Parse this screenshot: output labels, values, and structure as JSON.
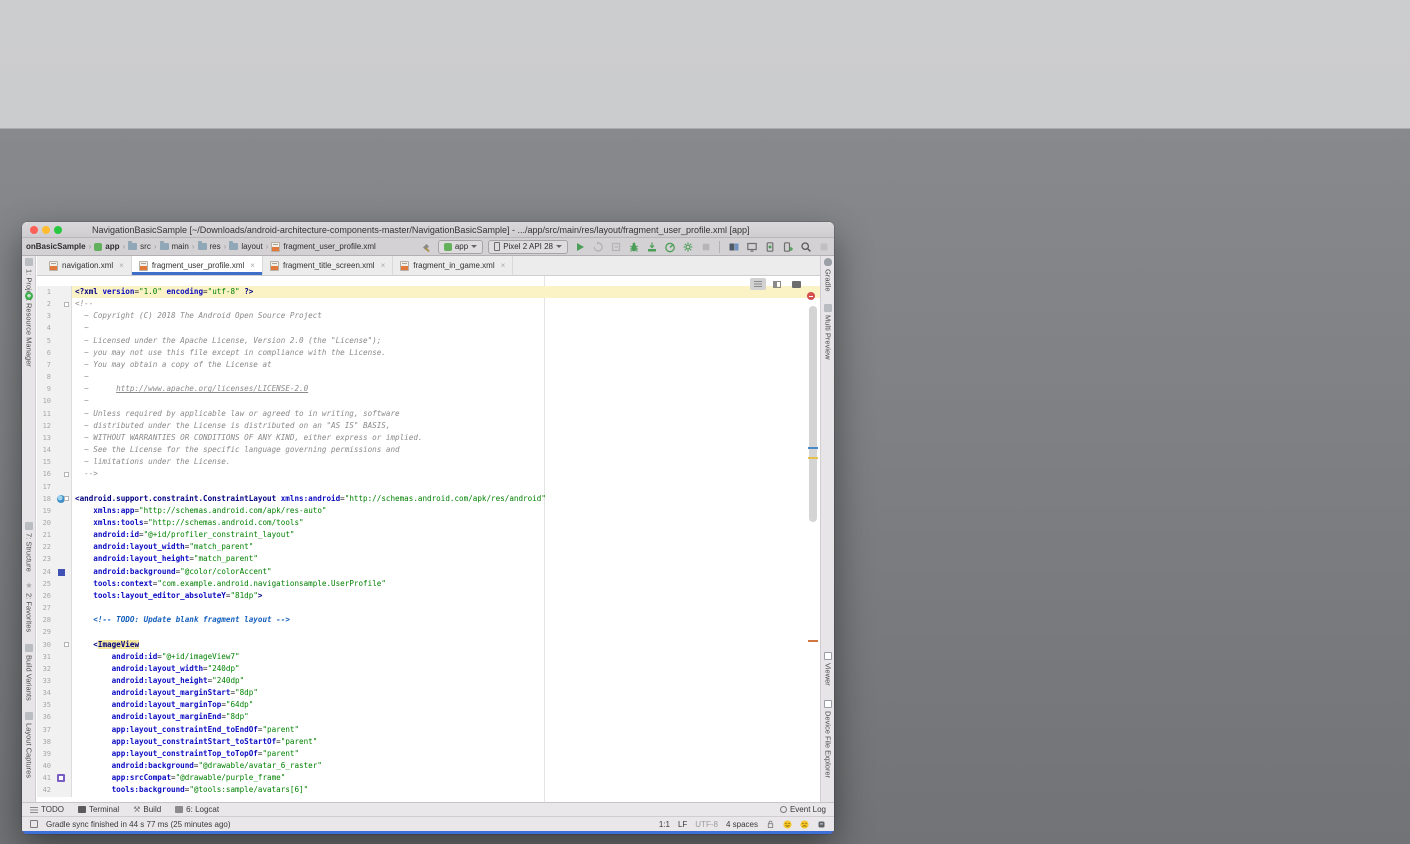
{
  "window": {
    "title": "NavigationBasicSample [~/Downloads/android-architecture-components-master/NavigationBasicSample] - .../app/src/main/res/layout/fragment_user_profile.xml [app]"
  },
  "breadcrumbs": [
    {
      "label": "onBasicSample",
      "icon": "none"
    },
    {
      "label": "app",
      "icon": "module"
    },
    {
      "label": "src",
      "icon": "folder"
    },
    {
      "label": "main",
      "icon": "folder"
    },
    {
      "label": "res",
      "icon": "folder"
    },
    {
      "label": "layout",
      "icon": "folder"
    },
    {
      "label": "fragment_user_profile.xml",
      "icon": "xml"
    }
  ],
  "toolbar": {
    "run_config_label": "app",
    "device_label": "Pixel 2 API 28",
    "icons_left": [
      "hammer"
    ],
    "icons_run_group": [
      "run",
      "apply-changes",
      "apply-code-changes",
      "debug",
      "attach-debugger",
      "profile",
      "profiler-settings",
      "stop"
    ],
    "icons_right_group": [
      "sync-gradle",
      "layout-validation",
      "avd-manager",
      "attach-debugger-to-process",
      "search-everywhere",
      "project-structure"
    ]
  },
  "tabs": [
    {
      "label": "navigation.xml",
      "active": false
    },
    {
      "label": "fragment_user_profile.xml",
      "active": true
    },
    {
      "label": "fragment_title_screen.xml",
      "active": false
    },
    {
      "label": "fragment_in_game.xml",
      "active": false
    }
  ],
  "left_strip": [
    {
      "label": "1: Project",
      "icon": "project"
    },
    {
      "label": "Resource Manager",
      "icon": "resource-manager"
    },
    {
      "label": "7: Structure",
      "icon": "structure"
    },
    {
      "label": "2: Favorites",
      "icon": "favorites"
    },
    {
      "label": "Build Variants",
      "icon": "build-variants"
    },
    {
      "label": "Layout Captures",
      "icon": "layout-captures"
    }
  ],
  "right_strip": [
    {
      "label": "Gradle",
      "icon": "gradle"
    },
    {
      "label": "Multi Preview",
      "icon": "multi-preview"
    },
    {
      "label": "Viewer",
      "icon": "viewer"
    },
    {
      "label": "Device File Explorer",
      "icon": "device-file-explorer"
    }
  ],
  "editor": {
    "view_modes": [
      "code",
      "split",
      "design"
    ],
    "active_view": "code",
    "caret_line": 1,
    "fold_lines": [
      2,
      16,
      18,
      30
    ],
    "gutter_icons": {
      "18": "preview",
      "24": "swatch",
      "41": "thumb"
    },
    "lines": [
      {
        "n": 1,
        "tokens": [
          [
            "<?xml ",
            "t"
          ],
          [
            "version",
            "a"
          ],
          [
            "=",
            "p"
          ],
          [
            "\"1.0\" ",
            "v"
          ],
          [
            "encoding",
            "a"
          ],
          [
            "=",
            "p"
          ],
          [
            "\"utf-8\" ",
            "v"
          ],
          [
            "?>",
            "t"
          ]
        ]
      },
      {
        "n": 2,
        "tokens": [
          [
            "<!--",
            "c"
          ]
        ]
      },
      {
        "n": 3,
        "tokens": [
          [
            "  ~ Copyright (C) 2018 The Android Open Source Project",
            "c"
          ]
        ]
      },
      {
        "n": 4,
        "tokens": [
          [
            "  ~",
            "c"
          ]
        ]
      },
      {
        "n": 5,
        "tokens": [
          [
            "  ~ Licensed under the Apache License, Version 2.0 (the \"License\");",
            "c"
          ]
        ]
      },
      {
        "n": 6,
        "tokens": [
          [
            "  ~ you may not use this file except in compliance with the License.",
            "c"
          ]
        ]
      },
      {
        "n": 7,
        "tokens": [
          [
            "  ~ You may obtain a copy of the License at",
            "c"
          ]
        ]
      },
      {
        "n": 8,
        "tokens": [
          [
            "  ~",
            "c"
          ]
        ]
      },
      {
        "n": 9,
        "tokens": [
          [
            "  ~      ",
            "c"
          ],
          [
            "http://www.apache.org/licenses/LICENSE-2.0",
            "u"
          ]
        ]
      },
      {
        "n": 10,
        "tokens": [
          [
            "  ~",
            "c"
          ]
        ]
      },
      {
        "n": 11,
        "tokens": [
          [
            "  ~ Unless required by applicable law or agreed to in writing, software",
            "c"
          ]
        ]
      },
      {
        "n": 12,
        "tokens": [
          [
            "  ~ distributed under the License is distributed on an \"AS IS\" BASIS,",
            "c"
          ]
        ]
      },
      {
        "n": 13,
        "tokens": [
          [
            "  ~ WITHOUT WARRANTIES OR CONDITIONS OF ANY KIND, either express or implied.",
            "c"
          ]
        ]
      },
      {
        "n": 14,
        "tokens": [
          [
            "  ~ See the License for the specific language governing permissions and",
            "c"
          ]
        ]
      },
      {
        "n": 15,
        "tokens": [
          [
            "  ~ limitations under the License.",
            "c"
          ]
        ]
      },
      {
        "n": 16,
        "tokens": [
          [
            "  -->",
            "c"
          ]
        ]
      },
      {
        "n": 17,
        "tokens": []
      },
      {
        "n": 18,
        "tokens": [
          [
            "<android.support.constraint.ConstraintLayout ",
            "t"
          ],
          [
            "xmlns:android",
            "a"
          ],
          [
            "=",
            "p"
          ],
          [
            "\"http://schemas.android.com/apk/res/android\"",
            "v"
          ]
        ]
      },
      {
        "n": 19,
        "tokens": [
          [
            "    ",
            "p"
          ],
          [
            "xmlns:app",
            "a"
          ],
          [
            "=",
            "p"
          ],
          [
            "\"http://schemas.android.com/apk/res-auto\"",
            "v"
          ]
        ]
      },
      {
        "n": 20,
        "tokens": [
          [
            "    ",
            "p"
          ],
          [
            "xmlns:tools",
            "a"
          ],
          [
            "=",
            "p"
          ],
          [
            "\"http://schemas.android.com/tools\"",
            "v"
          ]
        ]
      },
      {
        "n": 21,
        "tokens": [
          [
            "    ",
            "p"
          ],
          [
            "android:id",
            "a"
          ],
          [
            "=",
            "p"
          ],
          [
            "\"@+id/profiler_constraint_layout\"",
            "v"
          ]
        ]
      },
      {
        "n": 22,
        "tokens": [
          [
            "    ",
            "p"
          ],
          [
            "android:layout_width",
            "a"
          ],
          [
            "=",
            "p"
          ],
          [
            "\"match_parent\"",
            "v"
          ]
        ]
      },
      {
        "n": 23,
        "tokens": [
          [
            "    ",
            "p"
          ],
          [
            "android:layout_height",
            "a"
          ],
          [
            "=",
            "p"
          ],
          [
            "\"match_parent\"",
            "v"
          ]
        ]
      },
      {
        "n": 24,
        "tokens": [
          [
            "    ",
            "p"
          ],
          [
            "android:background",
            "a"
          ],
          [
            "=",
            "p"
          ],
          [
            "\"@color/colorAccent\"",
            "v"
          ]
        ]
      },
      {
        "n": 25,
        "tokens": [
          [
            "    ",
            "p"
          ],
          [
            "tools:context",
            "a"
          ],
          [
            "=",
            "p"
          ],
          [
            "\"com.example.android.navigationsample.UserProfile\"",
            "v"
          ]
        ]
      },
      {
        "n": 26,
        "tokens": [
          [
            "    ",
            "p"
          ],
          [
            "tools:layout_editor_absoluteY",
            "a"
          ],
          [
            "=",
            "p"
          ],
          [
            "\"81dp\"",
            "v"
          ],
          [
            ">",
            "t"
          ]
        ]
      },
      {
        "n": 27,
        "tokens": []
      },
      {
        "n": 28,
        "tokens": [
          [
            "    ",
            "p"
          ],
          [
            "<!-- TODO: Update blank fragment layout -->",
            "d"
          ]
        ]
      },
      {
        "n": 29,
        "tokens": []
      },
      {
        "n": 30,
        "tokens": [
          [
            "    ",
            "p"
          ],
          [
            "<",
            "t"
          ],
          [
            "ImageView",
            "h"
          ]
        ]
      },
      {
        "n": 31,
        "tokens": [
          [
            "        ",
            "p"
          ],
          [
            "android:id",
            "a"
          ],
          [
            "=",
            "p"
          ],
          [
            "\"@+id/imageView7\"",
            "v"
          ]
        ]
      },
      {
        "n": 32,
        "tokens": [
          [
            "        ",
            "p"
          ],
          [
            "android:layout_width",
            "a"
          ],
          [
            "=",
            "p"
          ],
          [
            "\"240dp\"",
            "v"
          ]
        ]
      },
      {
        "n": 33,
        "tokens": [
          [
            "        ",
            "p"
          ],
          [
            "android:layout_height",
            "a"
          ],
          [
            "=",
            "p"
          ],
          [
            "\"240dp\"",
            "v"
          ]
        ]
      },
      {
        "n": 34,
        "tokens": [
          [
            "        ",
            "p"
          ],
          [
            "android:layout_marginStart",
            "a"
          ],
          [
            "=",
            "p"
          ],
          [
            "\"8dp\"",
            "v"
          ]
        ]
      },
      {
        "n": 35,
        "tokens": [
          [
            "        ",
            "p"
          ],
          [
            "android:layout_marginTop",
            "a"
          ],
          [
            "=",
            "p"
          ],
          [
            "\"64dp\"",
            "v"
          ]
        ]
      },
      {
        "n": 36,
        "tokens": [
          [
            "        ",
            "p"
          ],
          [
            "android:layout_marginEnd",
            "a"
          ],
          [
            "=",
            "p"
          ],
          [
            "\"8dp\"",
            "v"
          ]
        ]
      },
      {
        "n": 37,
        "tokens": [
          [
            "        ",
            "p"
          ],
          [
            "app:layout_constraintEnd_toEndOf",
            "a"
          ],
          [
            "=",
            "p"
          ],
          [
            "\"parent\"",
            "v"
          ]
        ]
      },
      {
        "n": 38,
        "tokens": [
          [
            "        ",
            "p"
          ],
          [
            "app:layout_constraintStart_toStartOf",
            "a"
          ],
          [
            "=",
            "p"
          ],
          [
            "\"parent\"",
            "v"
          ]
        ]
      },
      {
        "n": 39,
        "tokens": [
          [
            "        ",
            "p"
          ],
          [
            "app:layout_constraintTop_toTopOf",
            "a"
          ],
          [
            "=",
            "p"
          ],
          [
            "\"parent\"",
            "v"
          ]
        ]
      },
      {
        "n": 40,
        "tokens": [
          [
            "        ",
            "p"
          ],
          [
            "android:background",
            "a"
          ],
          [
            "=",
            "p"
          ],
          [
            "\"@drawable/avatar_6_raster\"",
            "v"
          ]
        ]
      },
      {
        "n": 41,
        "tokens": [
          [
            "        ",
            "p"
          ],
          [
            "app:srcCompat",
            "a"
          ],
          [
            "=",
            "p"
          ],
          [
            "\"@drawable/purple_frame\"",
            "v"
          ]
        ]
      },
      {
        "n": 42,
        "tokens": [
          [
            "        ",
            "p"
          ],
          [
            "tools:background",
            "a"
          ],
          [
            "=",
            "p"
          ],
          [
            "\"@tools:sample/avatars[6]\"",
            "v"
          ]
        ]
      }
    ]
  },
  "bottom_bar": {
    "items": [
      "TODO",
      "Terminal",
      "Build",
      "6: Logcat"
    ],
    "event_log_label": "Event Log"
  },
  "status_bar": {
    "message": "Gradle sync finished in 44 s 77 ms (25 minutes ago)",
    "caret_position": "1:1",
    "line_separator": "LF",
    "encoding": "UTF-8",
    "indent": "4 spaces"
  },
  "colors": {
    "tab_accent": "#3d6fc9",
    "caret_row": "#fbf3c5",
    "occurrence_highlight": "#f3e6a0",
    "color_swatch_line24": "#3f51b5",
    "error_indicator": "#d64f4f",
    "traffic_red": "#ff5f57",
    "traffic_yellow": "#febc2e",
    "traffic_green": "#28c840"
  }
}
